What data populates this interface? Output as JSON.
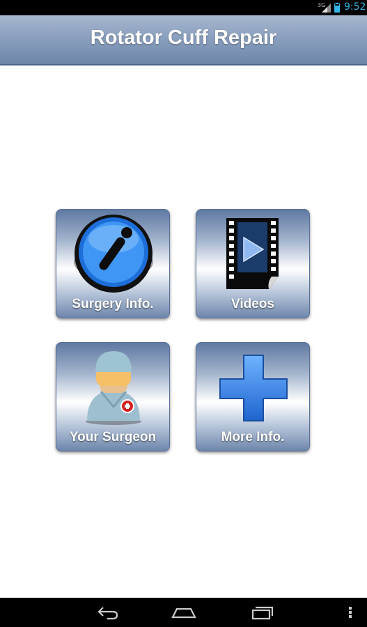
{
  "status_bar": {
    "network": "3G",
    "time": "9:52",
    "icons": [
      "signal-icon",
      "battery-icon"
    ]
  },
  "header": {
    "title": "Rotator Cuff Repair"
  },
  "tiles": [
    {
      "label": "Surgery Info.",
      "icon": "info-icon"
    },
    {
      "label": "Videos",
      "icon": "video-film-icon"
    },
    {
      "label": "Your Surgeon",
      "icon": "surgeon-icon"
    },
    {
      "label": "More Info.",
      "icon": "plus-icon"
    }
  ],
  "nav_bar": {
    "buttons": [
      "back-icon",
      "home-icon",
      "recents-icon",
      "menu-icon"
    ]
  },
  "colors": {
    "header_top": "#a6b6ce",
    "header_bottom": "#6d85a8",
    "status_accent": "#33b5e5",
    "plus_blue": "#2f7fe6"
  }
}
